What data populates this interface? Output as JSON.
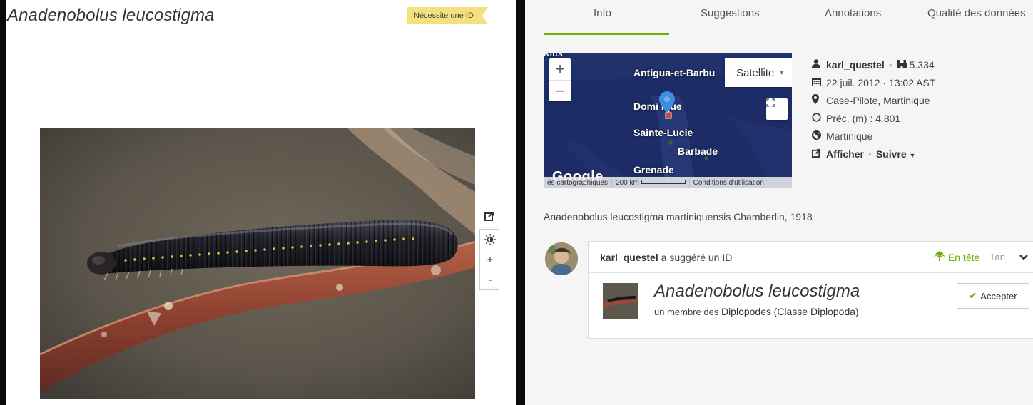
{
  "observation": {
    "title": "Anadenobolus leucostigma",
    "quality_badge": "Nécessite une ID"
  },
  "photo_controls": {
    "external_icon": "external-link-icon",
    "brightness_icon": "brightness-icon",
    "zoom_in": "+",
    "zoom_out": "-"
  },
  "tabs": [
    {
      "label": "Info",
      "active": true
    },
    {
      "label": "Suggestions",
      "active": false
    },
    {
      "label": "Annotations",
      "active": false
    },
    {
      "label": "Qualité des données",
      "active": false
    }
  ],
  "map": {
    "zoom_in": "+",
    "zoom_out": "−",
    "type_selector": "Satellite",
    "labels": {
      "top_clipped": "Kitts",
      "antigua": "Antigua-et-Barbu",
      "dominique": "Domi   ique",
      "sainte_lucie": "Sainte-Lucie",
      "barbade": "Barbade",
      "grenade": "Grenade"
    },
    "provider_logo": "Google",
    "footer": {
      "data": "es cartographiques",
      "scale": "200 km",
      "terms": "Conditions d'utilisation"
    }
  },
  "meta": {
    "user": "karl_questel",
    "observations_count": "5.334",
    "date": "22 juil. 2012 · 13:02 AST",
    "place": "Case-Pilote, Martinique",
    "precision": "Préc. (m) : 4.801",
    "region": "Martinique",
    "view_link": "Afficher",
    "follow_link": "Suivre"
  },
  "taxon_line": "Anadenobolus leucostigma martiniquensis Chamberlin, 1918",
  "identification": {
    "user": "karl_questel",
    "action": "a suggéré un ID",
    "status": "En tête",
    "age": "1an",
    "taxon_name": "Anadenobolus leucostigma",
    "member_prefix": "un membre des",
    "member_group": "Diplopodes",
    "member_class": "(Classe Diplopoda)",
    "accept_label": "Accepter"
  },
  "colors": {
    "accent_green": "#74ac00",
    "badge_yellow": "#f4e17e",
    "map_ocean": "#1c2b63"
  }
}
